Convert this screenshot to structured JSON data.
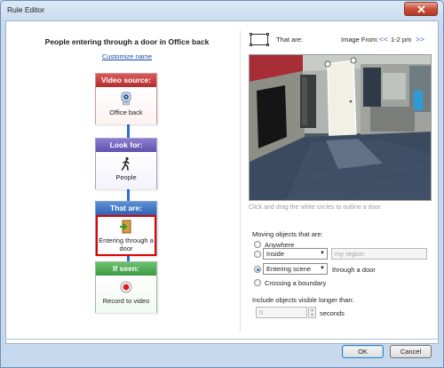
{
  "window": {
    "title": "Rule Editor"
  },
  "rule": {
    "title": "People entering through a door in Office back",
    "customize_label": "Customize name"
  },
  "steps": [
    {
      "header": "Video source:",
      "label": "Office back",
      "icon": "camera-icon",
      "color": "#c03a3a"
    },
    {
      "header": "Look for:",
      "label": "People",
      "icon": "person-walking-icon",
      "color": "#6b5cb8"
    },
    {
      "header": "That are:",
      "label": "Entering through a door",
      "icon": "door-enter-icon",
      "color": "#3b6fbd",
      "selected": true
    },
    {
      "header": "If seen:",
      "label": "Record to video",
      "icon": "record-icon",
      "color": "#4aa84f"
    }
  ],
  "preview": {
    "that_are_label": "That are:",
    "image_from_label": "Image From:",
    "prev_symbol": "<<",
    "range": "1-2 pm",
    "next_symbol": ">>",
    "hint": "Click and drag the white circles to outline a door."
  },
  "options": {
    "moving_label": "Moving objects that are:",
    "anywhere": "Anywhere",
    "inside_select": "Inside",
    "region_placeholder": "my region",
    "entering_select": "Entering scene",
    "through_label": "through a door",
    "crossing": "Crossing a boundary",
    "selected": "entering",
    "include_label": "Include objects visible longer than:",
    "duration_value": "0",
    "seconds_label": "seconds"
  },
  "buttons": {
    "ok": "OK",
    "cancel": "Cancel"
  }
}
